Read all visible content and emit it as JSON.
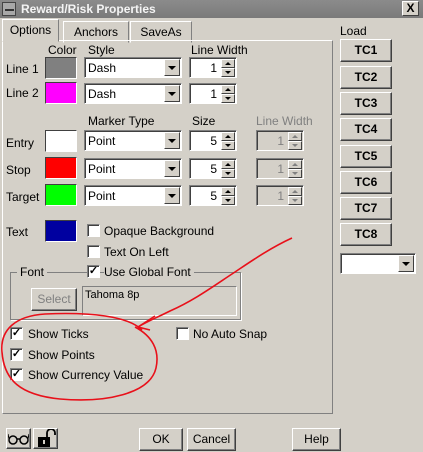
{
  "window": {
    "title": "Reward/Risk Properties",
    "close_label": "X"
  },
  "tabs": [
    {
      "label": "Options",
      "active": true
    },
    {
      "label": "Anchors",
      "active": false
    },
    {
      "label": "SaveAs",
      "active": false
    }
  ],
  "headers": {
    "color": "Color",
    "style": "Style",
    "line_width": "Line Width",
    "marker_type": "Marker Type",
    "size": "Size",
    "line_width2": "Line Width",
    "load": "Load"
  },
  "lines": [
    {
      "label": "Line 1",
      "color": "#808080",
      "style": "Dash",
      "width": "1"
    },
    {
      "label": "Line 2",
      "color": "#ff00ff",
      "style": "Dash",
      "width": "1"
    }
  ],
  "markers": [
    {
      "label": "Entry",
      "color": "#ffffff",
      "type": "Point",
      "size": "5",
      "line_width": "1"
    },
    {
      "label": "Stop",
      "color": "#ff0000",
      "type": "Point",
      "size": "5",
      "line_width": "1"
    },
    {
      "label": "Target",
      "color": "#00ff00",
      "type": "Point",
      "size": "5",
      "line_width": "1"
    }
  ],
  "text": {
    "label": "Text",
    "color": "#0000a0",
    "opaque_background": "Opaque Background",
    "text_on_left": "Text On Left"
  },
  "font": {
    "group_label": "Font",
    "use_global": "Use Global Font",
    "select_label": "Select",
    "preview": "Tahoma  8p"
  },
  "options": {
    "show_ticks": "Show Ticks",
    "show_points": "Show Points",
    "show_currency": "Show Currency Value",
    "no_auto_snap": "No Auto Snap"
  },
  "load_buttons": [
    "TC1",
    "TC2",
    "TC3",
    "TC4",
    "TC5",
    "TC6",
    "TC7",
    "TC8"
  ],
  "load_combo": "",
  "buttons": {
    "ok": "OK",
    "cancel": "Cancel",
    "help": "Help"
  },
  "checks": {
    "opaque_background": false,
    "text_on_left": false,
    "use_global_font": true,
    "show_ticks": true,
    "show_points": true,
    "show_currency": true,
    "no_auto_snap": false
  },
  "icons": {
    "glasses": "glasses-icon",
    "lock": "unlocked-padlock-icon"
  }
}
